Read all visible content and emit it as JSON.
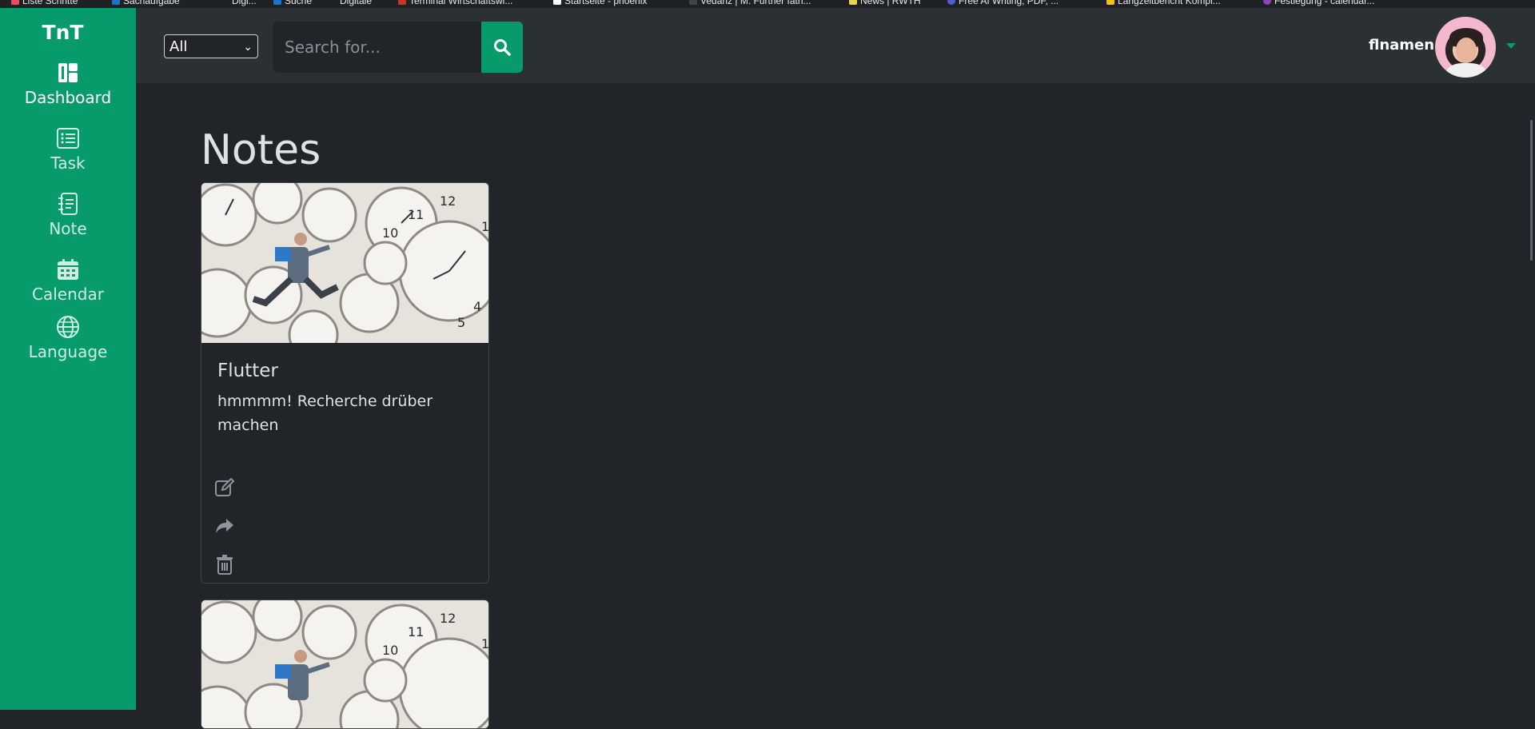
{
  "bookmarks": [
    "Liste Schritte",
    "Sachaufgabe",
    "Digi...",
    "Suche",
    "Digitale",
    "Terminal Wirtschaftswi...",
    "Startseite - phoenix",
    "Vedanz | M. Further fath...",
    "News | RWTH",
    "Free AI Writing, PDF, ...",
    "Langzeitbericht Kompl...",
    "Festlegung - calendar..."
  ],
  "sidebar": {
    "brand": "TnT",
    "items": [
      {
        "label": "Dashboard",
        "icon": "dashboard-icon"
      },
      {
        "label": "Task",
        "icon": "task-list-icon"
      },
      {
        "label": "Note",
        "icon": "notebook-icon"
      },
      {
        "label": "Calendar",
        "icon": "calendar-icon"
      },
      {
        "label": "Language",
        "icon": "globe-icon"
      }
    ]
  },
  "topbar": {
    "filter_selected": "All",
    "search_placeholder": "Search for...",
    "search_icon": "search-icon",
    "username": "flnamen",
    "accent": "#079a6a"
  },
  "main": {
    "title": "Notes",
    "notes": [
      {
        "title": "Flutter",
        "text": "hmmmm! Recherche drüber machen"
      },
      {
        "title": "",
        "text": ""
      }
    ]
  },
  "colors": {
    "sidebar": "#079a6a",
    "topbar": "#2b3035",
    "background": "#212529"
  }
}
